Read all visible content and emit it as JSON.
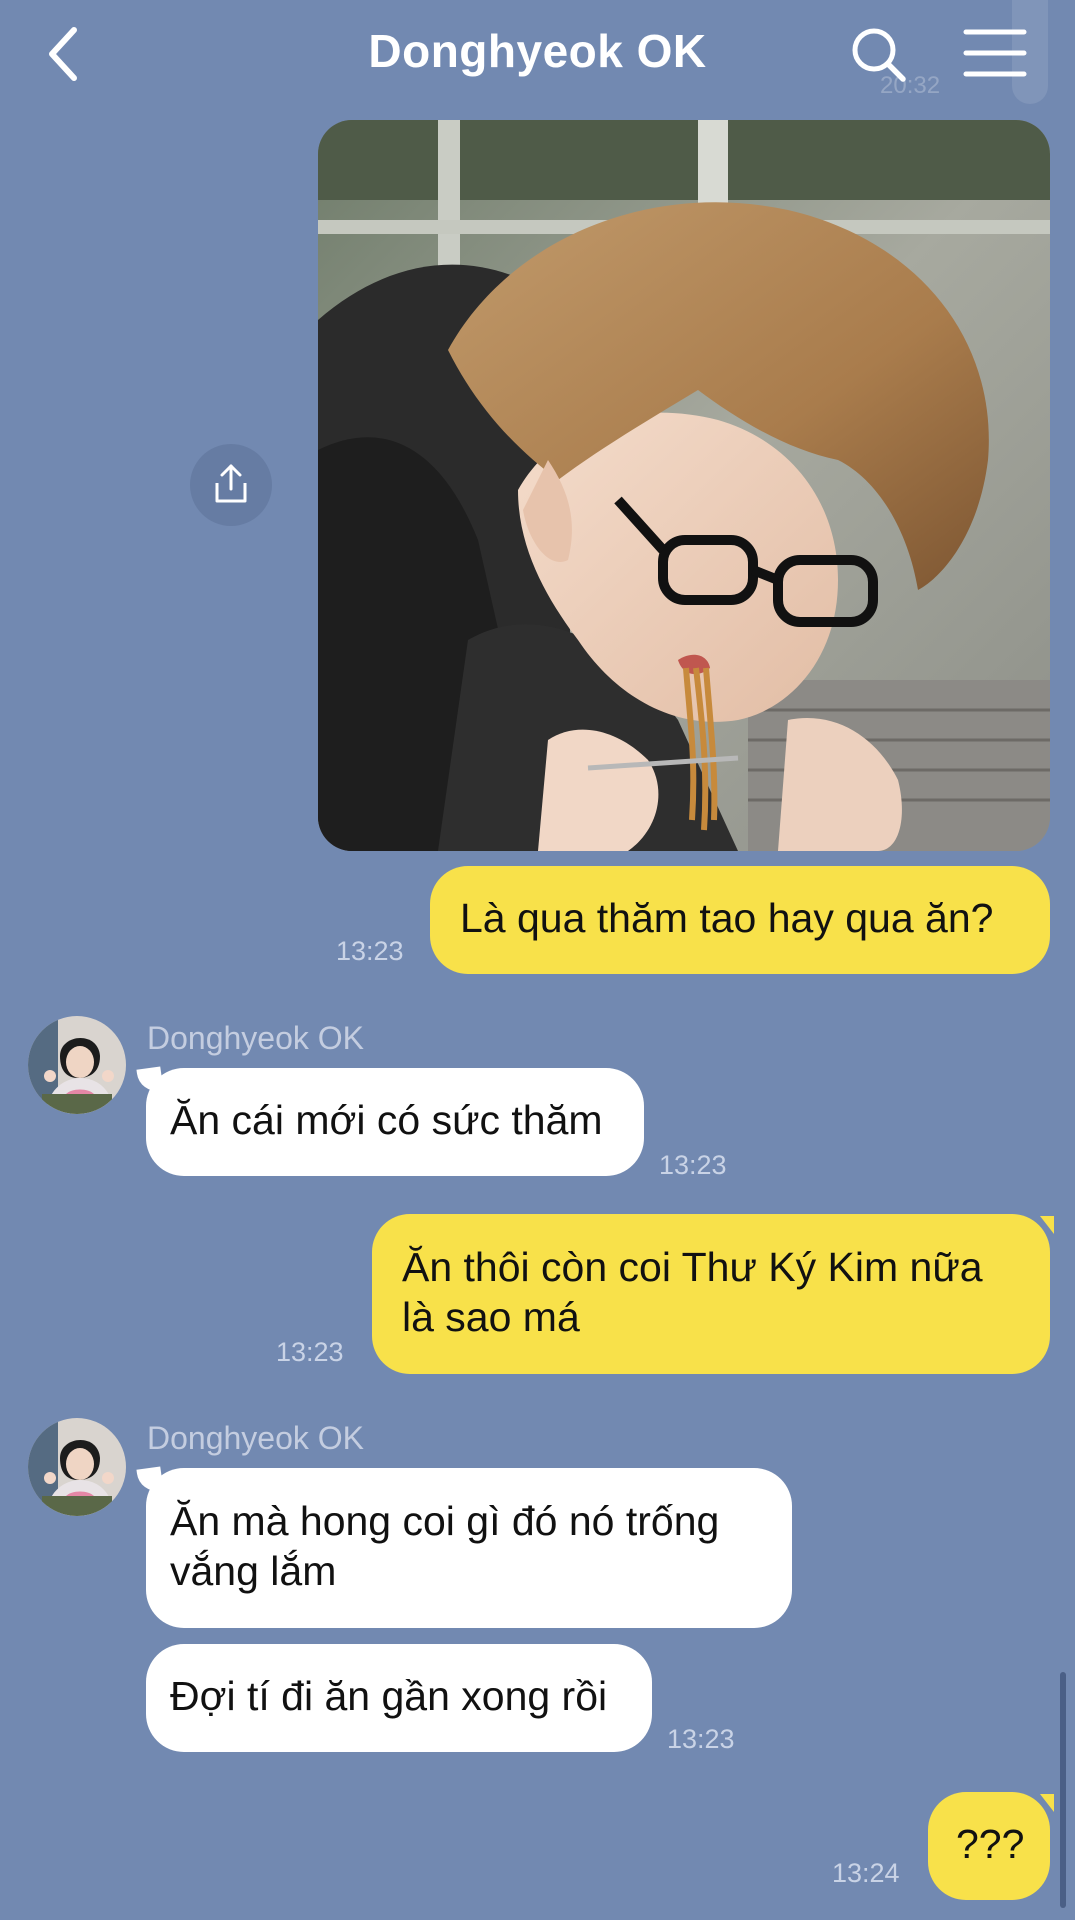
{
  "header": {
    "title": "Donghyeok OK",
    "ghost_time": "20:32"
  },
  "messages": [
    {
      "id": "m1",
      "type": "image",
      "direction": "sent"
    },
    {
      "id": "m2",
      "type": "text",
      "direction": "sent",
      "text": "Là qua thăm tao hay qua ăn?",
      "time": "13:23"
    },
    {
      "id": "m3",
      "type": "text",
      "direction": "received",
      "sender": "Donghyeok OK",
      "text": "Ăn cái mới có sức thăm",
      "time": "13:23"
    },
    {
      "id": "m4",
      "type": "text",
      "direction": "sent",
      "text": "Ăn thôi còn coi Thư Ký Kim nữa là sao má",
      "time": "13:23"
    },
    {
      "id": "m5",
      "type": "text",
      "direction": "received",
      "sender": "Donghyeok OK",
      "text": "Ăn mà hong coi gì đó nó trống vắng lắm"
    },
    {
      "id": "m6",
      "type": "text",
      "direction": "received",
      "text": "Đợi tí đi ăn gần xong rồi",
      "time": "13:23"
    },
    {
      "id": "m7",
      "type": "text",
      "direction": "sent",
      "text": "???",
      "time": "13:24"
    }
  ],
  "colors": {
    "background": "#7289b1",
    "sent_bubble": "#f8e14a",
    "received_bubble": "#ffffff"
  },
  "icons": [
    "chevron-left-icon",
    "search-icon",
    "hamburger-menu-icon",
    "share-icon"
  ]
}
